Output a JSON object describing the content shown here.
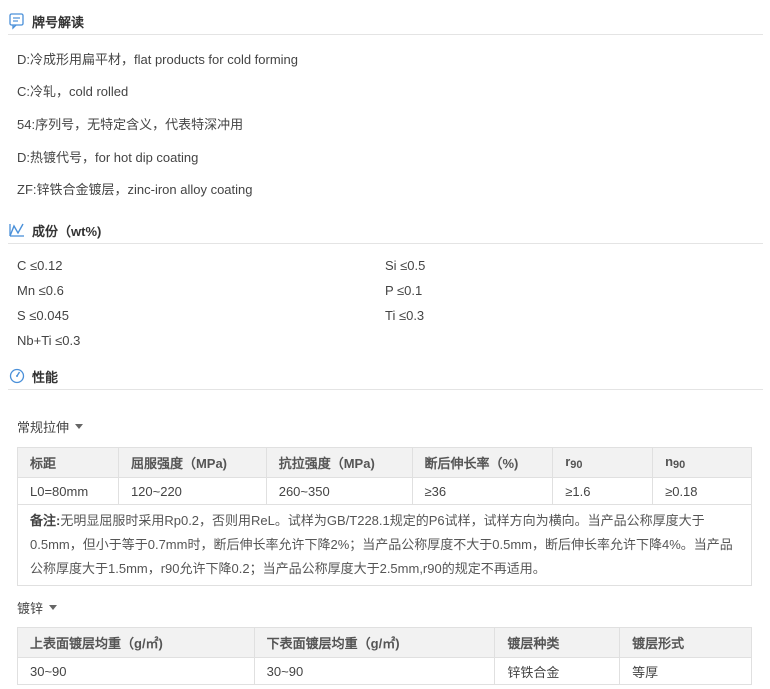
{
  "brand_section": {
    "title": "牌号解读",
    "lines": [
      "D:冷成形用扁平材，flat products for cold forming",
      "C:冷轧，cold rolled",
      "54:序列号，无特定含义，代表特深冲用",
      "D:热镀代号，for hot dip coating",
      "ZF:锌铁合金镀层，zinc-iron alloy coating"
    ]
  },
  "composition_section": {
    "title": "成份（wt%)",
    "left": [
      "C ≤0.12",
      "Mn ≤0.6",
      "S ≤0.045",
      "Nb+Ti ≤0.3"
    ],
    "right": [
      "Si ≤0.5",
      "P ≤0.1",
      "Ti ≤0.3"
    ]
  },
  "performance_section": {
    "title": "性能"
  },
  "tensile": {
    "label": "常规拉伸",
    "headers": [
      "标距",
      "屈服强度（MPa)",
      "抗拉强度（MPa)",
      "断后伸长率（%)",
      "r",
      "n"
    ],
    "header_subscripts": [
      "90",
      "90"
    ],
    "row": [
      "L0=80mm",
      "120~220",
      "260~350",
      "≥36",
      "≥1.6",
      "≥0.18"
    ],
    "note_label": "备注:",
    "note_text": "无明显屈服时采用Rp0.2，否则用ReL。试样为GB/T228.1规定的P6试样，试样方向为横向。当产品公称厚度大于0.5mm，但小于等于0.7mm时，断后伸长率允许下降2%；当产品公称厚度不大于0.5mm，断后伸长率允许下降4%。当产品公称厚度大于1.5mm，r90允许下降0.2；当产品公称厚度大于2.5mm,r90的规定不再适用。"
  },
  "coating": {
    "label": "镀锌",
    "headers": [
      "上表面镀层均重（g/㎡)",
      "下表面镀层均重（g/㎡)",
      "镀层种类",
      "镀层形式"
    ],
    "row": [
      "30~90",
      "30~90",
      "锌铁合金",
      "等厚"
    ]
  },
  "colors": {
    "accent": "#4a90d9",
    "header_bg": "#f2f2f2",
    "border": "#e0e0e0"
  }
}
